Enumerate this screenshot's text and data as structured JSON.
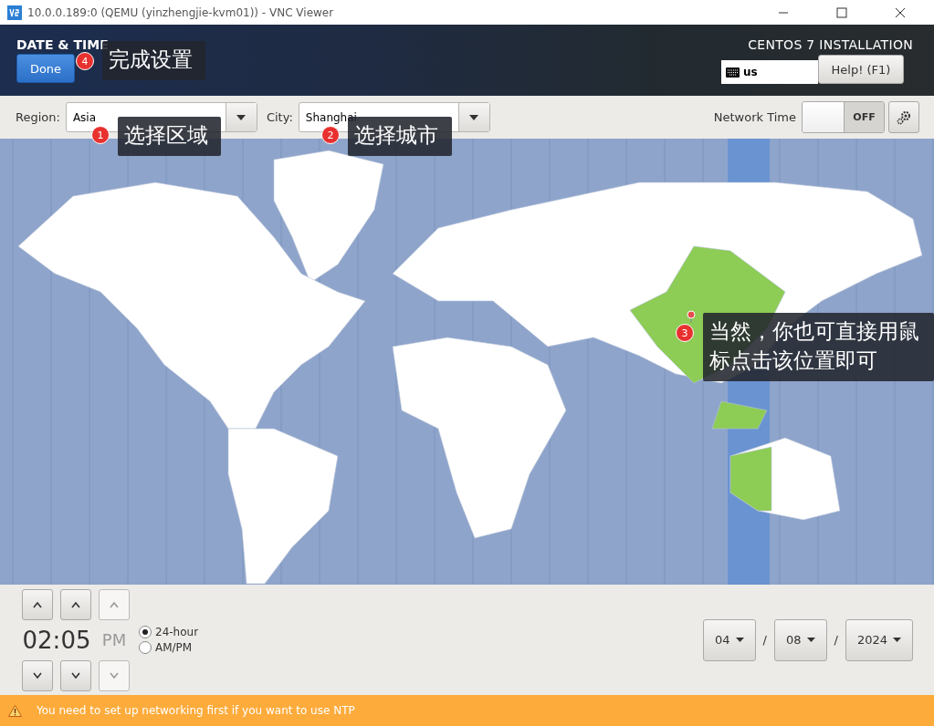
{
  "window": {
    "title": "10.0.0.189:0 (QEMU (yinzhengjie-kvm01)) - VNC Viewer"
  },
  "header": {
    "title": "DATE & TIME",
    "done_button": "Done",
    "product": "CENTOS 7 INSTALLATION",
    "keyboard_layout": "us",
    "help_button": "Help! (F1)"
  },
  "toolbar": {
    "region_label": "Region:",
    "region": "Asia",
    "city_label": "City:",
    "city": "Shanghai",
    "network_time_label": "Network Time",
    "network_time": {
      "on": false,
      "label": "OFF"
    }
  },
  "time": {
    "hours": "02",
    "separator": ":",
    "minutes": "05",
    "ampm": "PM",
    "ampm_disabled": true,
    "formats": [
      {
        "label": "24-hour",
        "selected": true
      },
      {
        "label": "AM/PM",
        "selected": false
      }
    ]
  },
  "date": {
    "month": "04",
    "day": "08",
    "year": "2024",
    "separators": [
      "/",
      "/"
    ]
  },
  "warning": "You need to set up networking first if you want to use NTP",
  "annotations": [
    {
      "number": "4",
      "text": "完成设置"
    },
    {
      "number": "1",
      "text": "选择区域"
    },
    {
      "number": "2",
      "text": "选择城市"
    },
    {
      "number": "3",
      "text": "当然，你也可直接用鼠标点击该位置即可"
    }
  ]
}
